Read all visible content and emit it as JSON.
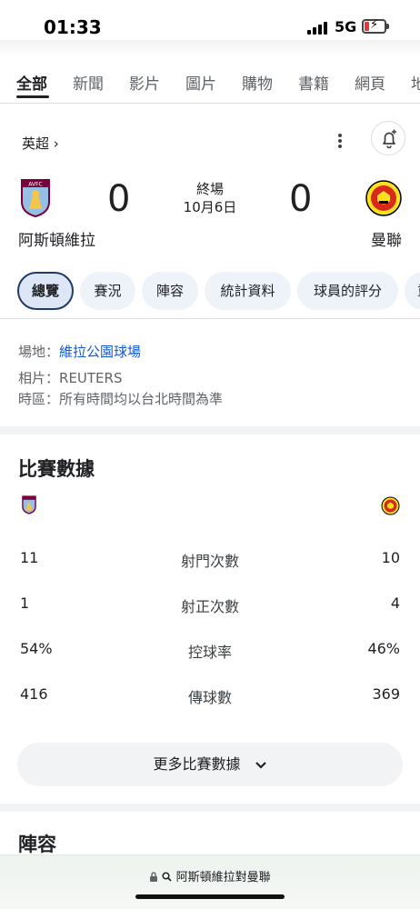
{
  "status_bar": {
    "time": "01:33",
    "network": "5G"
  },
  "search_tabs": [
    "全部",
    "新聞",
    "影片",
    "圖片",
    "購物",
    "書籍",
    "網頁",
    "地"
  ],
  "match": {
    "league": "英超 ›",
    "status": "終場",
    "date": "10月6日",
    "home": {
      "name": "阿斯頓維拉",
      "score": "0",
      "badge_text": "AVFC",
      "badge_color": "#7a003c"
    },
    "away": {
      "name": "曼聯",
      "score": "0",
      "badge_color": "#da291c"
    }
  },
  "chips": [
    "總覽",
    "賽況",
    "陣容",
    "統計資料",
    "球員的評分",
    "重"
  ],
  "info": {
    "venue_label": "場地：",
    "venue_value": "維拉公園球場",
    "photo_label": "相片：",
    "photo_value": "REUTERS",
    "tz_label": "時區：",
    "tz_value": "所有時間均以台北時間為準"
  },
  "match_stats": {
    "title": "比賽數據",
    "rows": [
      {
        "home": "11",
        "label": "射門次數",
        "away": "10"
      },
      {
        "home": "1",
        "label": "射正次數",
        "away": "4"
      },
      {
        "home": "54%",
        "label": "控球率",
        "away": "46%"
      },
      {
        "home": "416",
        "label": "傳球數",
        "away": "369"
      }
    ],
    "more_label": "更多比賽數據"
  },
  "lineups_title": "陣容",
  "address_bar": {
    "text": "阿斯頓維拉對曼聯"
  },
  "icons": {
    "menu": "more-vert-icon",
    "alert": "bell-add-icon",
    "lock": "lock-icon",
    "search": "search-icon",
    "chevron": "chevron-down-icon"
  }
}
